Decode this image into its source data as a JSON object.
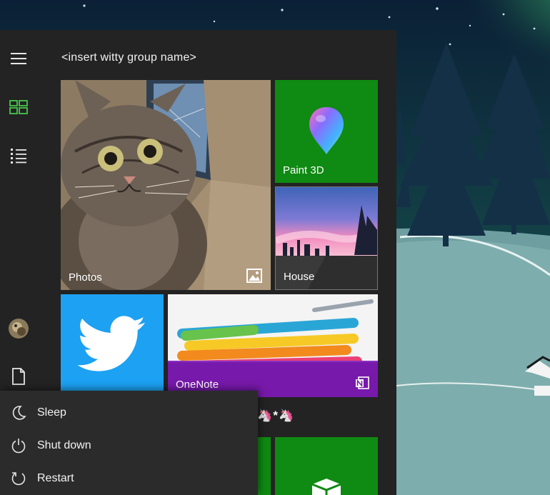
{
  "start_menu": {
    "group_title": "<insert witty group name>",
    "tiles": [
      {
        "label": "Photos",
        "icon": "image-icon"
      },
      {
        "label": "Paint 3D",
        "icon": "paint-3d-icon"
      },
      {
        "label": "House",
        "icon": "house-photo"
      },
      {
        "label": "",
        "icon": "twitter-bird-icon"
      },
      {
        "label": "OneNote",
        "icon": "onenote-icon"
      },
      {
        "label": "",
        "icon": "store-icon"
      }
    ],
    "emoji_text": "🦄🦄*🦄"
  },
  "rail": {
    "items": [
      {
        "icon": "hamburger-menu-icon"
      },
      {
        "icon": "tiles-icon"
      },
      {
        "icon": "all-apps-list-icon"
      },
      {
        "icon": "user-avatar"
      },
      {
        "icon": "documents-icon"
      }
    ]
  },
  "power_menu": {
    "items": [
      {
        "label": "Sleep",
        "icon": "moon-icon"
      },
      {
        "label": "Shut down",
        "icon": "power-icon"
      },
      {
        "label": "Restart",
        "icon": "restart-icon"
      }
    ]
  },
  "colors": {
    "menu_bg": "#232323",
    "accent_green": "#0f8a12",
    "twitter_blue": "#1da1f2",
    "onenote_purple": "#7719aa",
    "flyout_bg": "#2b2b2b"
  }
}
